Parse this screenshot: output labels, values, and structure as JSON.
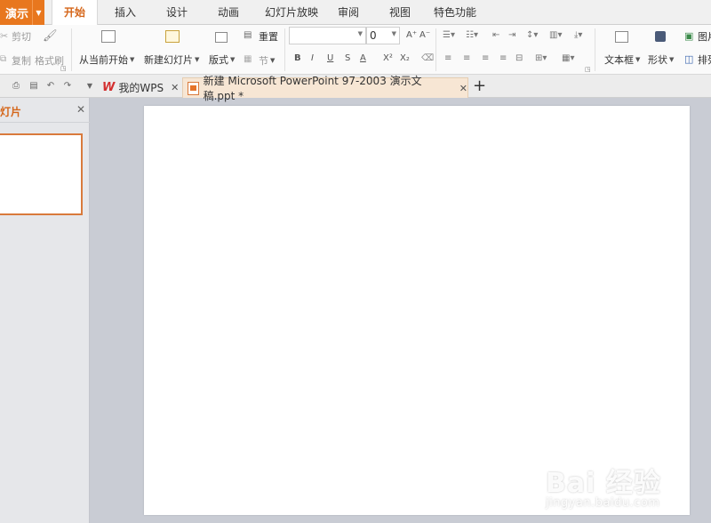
{
  "app": {
    "name": "演示"
  },
  "menu": {
    "tabs": [
      {
        "label": "开始",
        "active": true
      },
      {
        "label": "插入"
      },
      {
        "label": "设计"
      },
      {
        "label": "动画"
      },
      {
        "label": "幻灯片放映"
      },
      {
        "label": "审阅"
      },
      {
        "label": "视图"
      },
      {
        "label": "特色功能"
      }
    ]
  },
  "ribbon": {
    "cut": "剪切",
    "copy": "复制",
    "format_painter": "格式刷",
    "from_current": "从当前开始",
    "new_slide": "新建幻灯片",
    "layout": "版式",
    "reset": "重置",
    "section": "节",
    "font_size": "0",
    "text_box": "文本框",
    "shape": "形状",
    "picture": "图片",
    "arrange": "排列",
    "bold": "B",
    "italic": "I",
    "underline": "U",
    "strike": "S",
    "font_color": "A",
    "superscript": "X²",
    "subscript": "X₂"
  },
  "doc_tabs": [
    {
      "label": "我的WPS",
      "logo": "W"
    },
    {
      "label": "新建 Microsoft PowerPoint 97-2003 演示文稿.ppt *",
      "active": true
    }
  ],
  "left_panel": {
    "title": "灯片"
  },
  "watermark": {
    "main": "Bai 经验",
    "sub": "jingyan.baidu.com"
  },
  "colors": {
    "accent": "#e8771e",
    "active_tab_text": "#d5661a",
    "thumb_border": "#d97a3c"
  }
}
